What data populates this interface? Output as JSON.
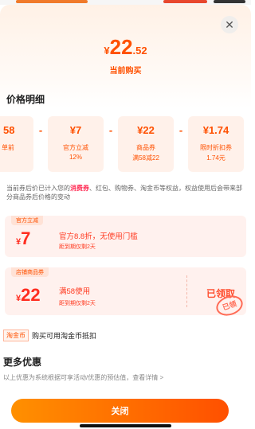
{
  "colors": {
    "accent": "#ff5000",
    "button_gradient": [
      "#ff9000",
      "#ff5000"
    ]
  },
  "header": {
    "close_icon": "close-icon"
  },
  "price": {
    "currency": "¥",
    "integer": "22",
    "decimal": ".52",
    "label": "当前购买"
  },
  "breakdown": {
    "title": "价格明细",
    "items": [
      {
        "value": "58",
        "label": "单前",
        "sub": ""
      },
      {
        "value": "¥7",
        "label": "官方立减",
        "sub": "12%"
      },
      {
        "value": "¥22",
        "label": "商品券",
        "sub": "满58减22"
      },
      {
        "value": "¥1.74",
        "label": "限时折扣券",
        "sub": "1.74元"
      }
    ],
    "operators": [
      "-",
      "-",
      "-"
    ],
    "note_prefix": "当前券后价已计入您的",
    "note_highlight": "消费券",
    "note_suffix": "、红包、购物券、淘金币等权益，权益使用后会带来部分商品券后价格的变动"
  },
  "coupons": [
    {
      "tag": "官方立减",
      "currency": "¥",
      "amount": "7",
      "title": "官方8.8折，无使用门槛",
      "expiry": "距到期仅剩2天"
    },
    {
      "tag": "店铺商品券",
      "currency": "¥",
      "amount": "22",
      "title": "满58使用",
      "expiry": "距到期仅剩2天",
      "status": "已领取",
      "stamp": "已领"
    }
  ],
  "taojinbi": {
    "tag": "淘金币",
    "text": "购买可用淘金币抵扣"
  },
  "more": {
    "title": "更多优惠",
    "desc": "以上优惠为系统根据可享活动/优惠的预估值，查看详情 >"
  },
  "footer": {
    "close_label": "关闭"
  }
}
